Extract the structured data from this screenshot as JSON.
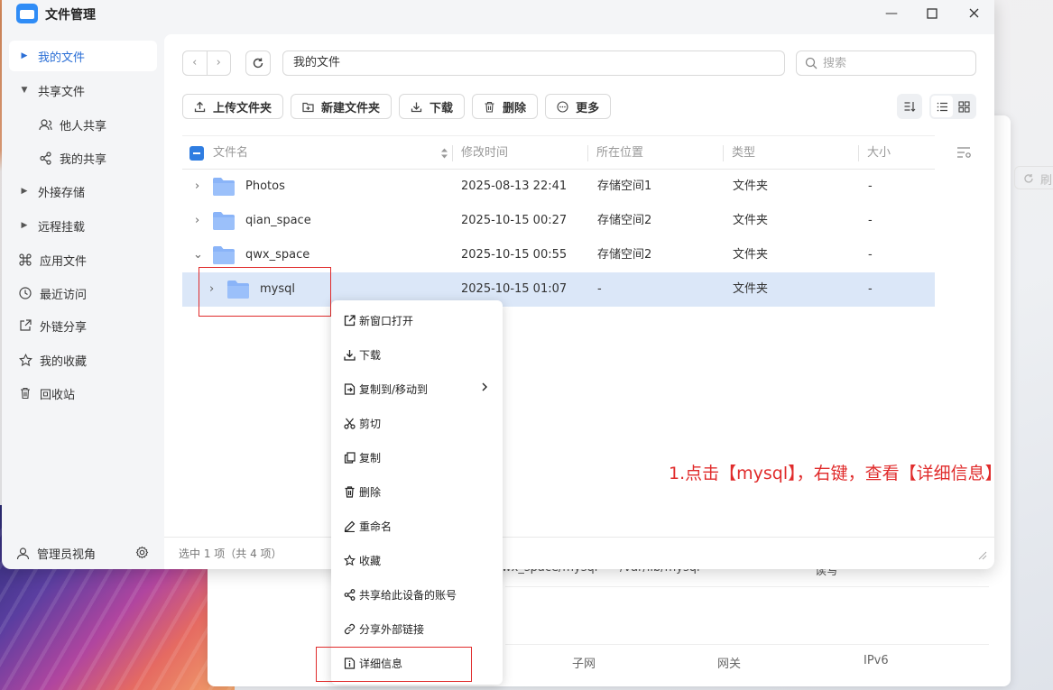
{
  "window": {
    "title": "文件管理"
  },
  "sidebar": {
    "items": [
      {
        "label": "我的文件",
        "icon": "caret-right-icon"
      },
      {
        "label": "共享文件",
        "icon": "caret-down-icon"
      },
      {
        "label": "他人共享",
        "icon": "users-icon"
      },
      {
        "label": "我的共享",
        "icon": "share-icon"
      },
      {
        "label": "外接存储",
        "icon": "caret-right-icon"
      },
      {
        "label": "远程挂载",
        "icon": "caret-right-icon"
      },
      {
        "label": "应用文件",
        "icon": "command-icon"
      },
      {
        "label": "最近访问",
        "icon": "clock-icon"
      },
      {
        "label": "外链分享",
        "icon": "external-share-icon"
      },
      {
        "label": "我的收藏",
        "icon": "star-icon"
      },
      {
        "label": "回收站",
        "icon": "trash-icon"
      }
    ],
    "footer_label": "管理员视角"
  },
  "nav": {
    "back": "‹",
    "forward": "›",
    "path": "我的文件",
    "search_placeholder": "搜索"
  },
  "toolbar": {
    "upload_folder": "上传文件夹",
    "new_folder": "新建文件夹",
    "download": "下载",
    "delete": "删除",
    "more": "更多"
  },
  "table": {
    "headers": {
      "name": "文件名",
      "modified": "修改时间",
      "location": "所在位置",
      "type": "类型",
      "size": "大小"
    },
    "rows": [
      {
        "expand": "›",
        "name": "Photos",
        "modified": "2025-08-13 22:41",
        "location": "存储空间1",
        "type": "文件夹",
        "size": "-"
      },
      {
        "expand": "›",
        "name": "qian_space",
        "modified": "2025-10-15 00:27",
        "location": "存储空间2",
        "type": "文件夹",
        "size": "-"
      },
      {
        "expand": "⌄",
        "name": "qwx_space",
        "modified": "2025-10-15 00:55",
        "location": "存储空间2",
        "type": "文件夹",
        "size": "-"
      },
      {
        "expand": "›",
        "name": "mysql",
        "modified": "2025-10-15 01:07",
        "location": "-",
        "type": "文件夹",
        "size": "-"
      }
    ]
  },
  "status": "选中 1 项（共 4 项）",
  "context_menu": {
    "items": [
      {
        "label": "新窗口打开",
        "icon": "open-new-window-icon"
      },
      {
        "label": "下载",
        "icon": "download-icon"
      },
      {
        "label": "复制到/移动到",
        "icon": "copy-move-icon",
        "arrow": "›"
      },
      {
        "label": "剪切",
        "icon": "scissors-icon"
      },
      {
        "label": "复制",
        "icon": "copy-icon"
      },
      {
        "label": "删除",
        "icon": "trash-icon"
      },
      {
        "label": "重命名",
        "icon": "pencil-icon"
      },
      {
        "label": "收藏",
        "icon": "star-icon"
      },
      {
        "label": "共享给此设备的账号",
        "icon": "share-icon"
      },
      {
        "label": "分享外部链接",
        "icon": "link-icon"
      },
      {
        "label": "详细信息",
        "icon": "info-icon"
      }
    ]
  },
  "annotation": {
    "text": "1.点击【mysql】，右键，查看【详细信息】"
  },
  "background_window": {
    "path_fragment": "wx_space/mysql",
    "path_fragment2": "/var/lib/mysql",
    "fragment3": "读写",
    "headers": [
      "子网",
      "网关",
      "IPv6"
    ],
    "refresh_label": "刷"
  },
  "colors": {
    "accent": "#2b6fd6",
    "folder": "#8ab4f8",
    "annotation": "#e02b2b",
    "selected_row": "#dbe7f8"
  }
}
